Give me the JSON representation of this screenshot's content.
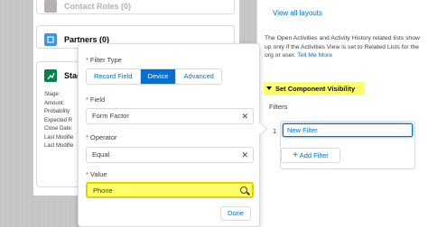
{
  "left_panel": {
    "cards": [
      {
        "title": "Contact Roles (0)"
      },
      {
        "title": "Partners (0)"
      },
      {
        "title": "Stag"
      }
    ],
    "stage_fields": [
      "Stage:",
      "Amount:",
      "Probability",
      "Expected R",
      "Close Date:",
      "Last Modifie",
      "Last Modifie"
    ]
  },
  "filter_popover": {
    "filter_type_label": "Filter Type",
    "filter_type_options": [
      "Record Field",
      "Device",
      "Advanced"
    ],
    "filter_type_selected": "Device",
    "field_label": "Field",
    "field_value": "Form Factor",
    "operator_label": "Operator",
    "operator_value": "Equal",
    "value_label": "Value",
    "value_value": "Phone",
    "done_label": "Done",
    "required_mark": "*",
    "clear_glyph": "✕"
  },
  "right_panel": {
    "view_all_link": "View all layouts",
    "info_text": "The Open Activities and Activity History related lists show up only if the Activities View is set to Related Lists for the org or user.",
    "info_link": "Tell Me More",
    "section_title": "Set Component Visibility",
    "filters_label": "Filters",
    "filter_index": "1",
    "filter_item": "New Filter",
    "add_filter_label": "Add Filter",
    "add_glyph": "+"
  },
  "colors": {
    "accent": "#0070d2",
    "highlight": "#ffff66",
    "partners_icon": "#3c97dd",
    "stage_icon": "#04844b"
  }
}
